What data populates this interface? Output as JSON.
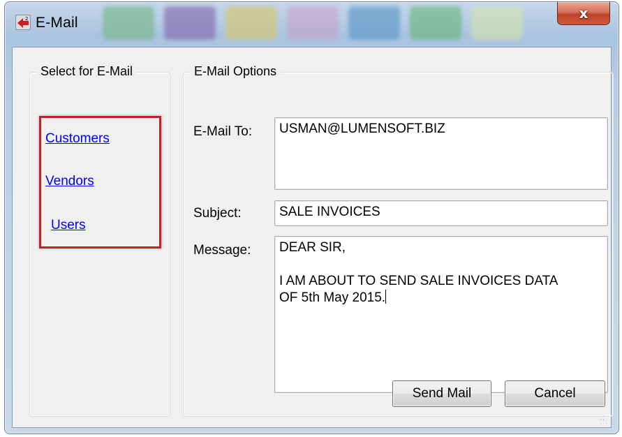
{
  "window": {
    "title": "E-Mail",
    "close_label": "x"
  },
  "colors": {
    "link": "#0000ff",
    "highlight": "#c0212a",
    "close": "#c1412a"
  },
  "left_panel": {
    "legend": "Select for E-Mail",
    "links": [
      {
        "label": "Customers"
      },
      {
        "label": "Vendors"
      },
      {
        "label": "Users"
      }
    ]
  },
  "options": {
    "legend": "E-Mail Options",
    "to_label": "E-Mail To:",
    "to_value": "USMAN@LUMENSOFT.BIZ",
    "subject_label": "Subject:",
    "subject_value": "SALE INVOICES",
    "message_label": "Message:",
    "message_value": "DEAR SIR,\n\nI AM ABOUT TO SEND SALE INVOICES DATA\nOF 5th May 2015."
  },
  "buttons": {
    "send": "Send Mail",
    "cancel": "Cancel"
  },
  "icons": {
    "app": "app-icon",
    "close": "close-icon",
    "grip": "resize-grip-icon"
  }
}
